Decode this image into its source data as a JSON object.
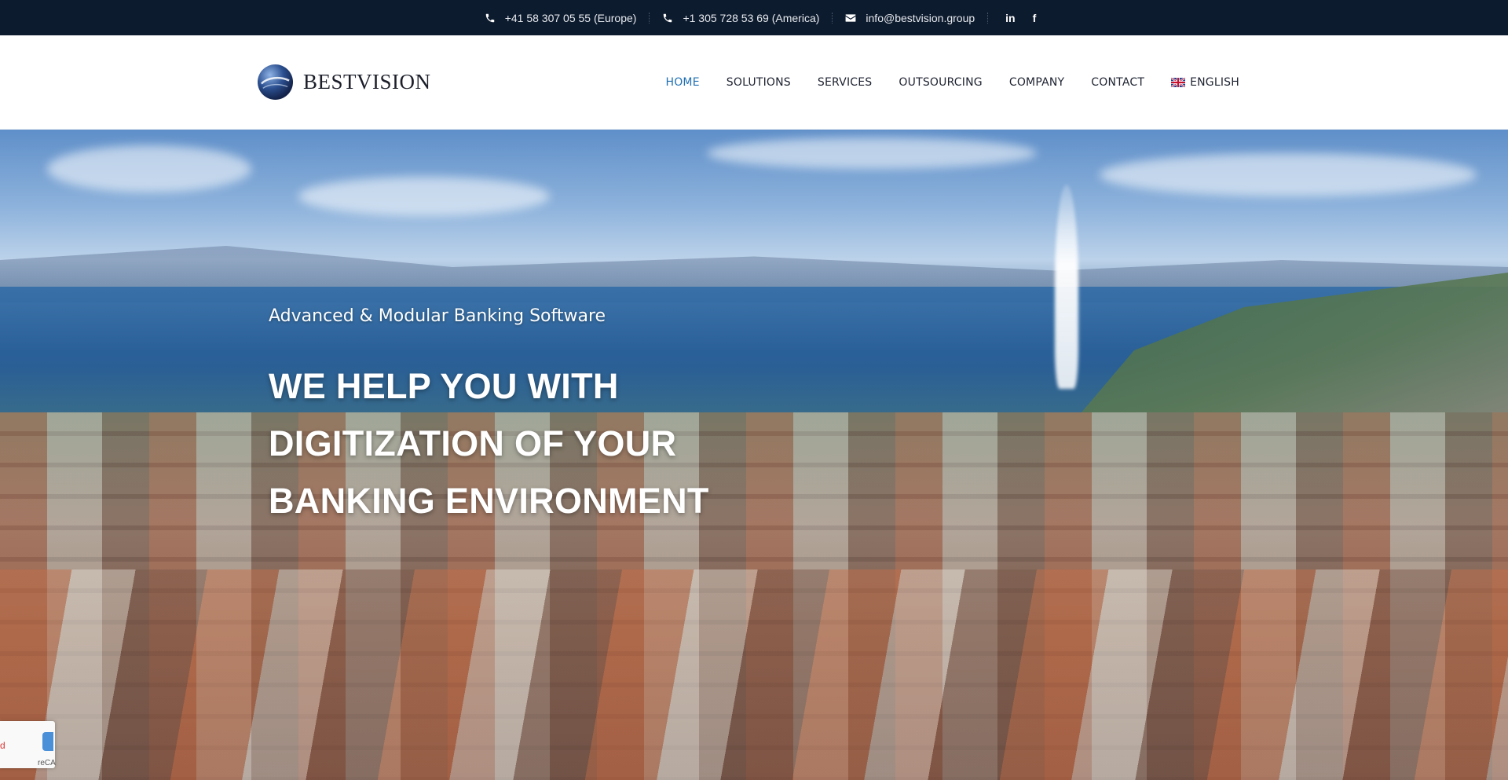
{
  "topbar": {
    "phone_europe": "+41 58 307 05 55 (Europe)",
    "phone_america": "+1 305 728 53 69 (America)",
    "email": "info@bestvision.group",
    "social": [
      "in",
      "f"
    ]
  },
  "header": {
    "logo_text": "BESTVISION",
    "nav": [
      "HOME",
      "SOLUTIONS",
      "SERVICES",
      "OUTSOURCING",
      "COMPANY",
      "CONTACT"
    ],
    "active_nav": "HOME",
    "language": "ENGLISH"
  },
  "hero": {
    "subtitle": "Advanced & Modular Banking Software",
    "title_line1": "WE HELP YOU WITH",
    "title_line2": "DIGITIZATION OF YOUR",
    "title_line3": "BANKING ENVIRONMENT"
  },
  "recaptcha": {
    "text": "reCA",
    "partial": "d"
  },
  "colors": {
    "topbar_bg": "#0d1b2e",
    "nav_active": "#1f6fb2",
    "nav_text": "#1d2230"
  },
  "icons": [
    "phone-icon",
    "envelope-icon",
    "linkedin-icon",
    "facebook-icon",
    "globe-logo-icon",
    "uk-flag-icon"
  ]
}
